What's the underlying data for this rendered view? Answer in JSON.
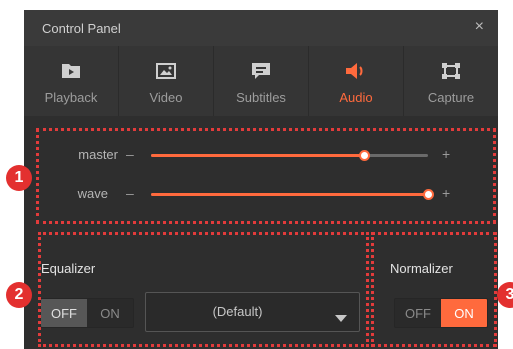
{
  "window": {
    "title": "Control Panel",
    "close_glyph": "×"
  },
  "tabs": [
    {
      "label": "Playback",
      "icon": "playback-icon",
      "active": false
    },
    {
      "label": "Video",
      "icon": "image-icon",
      "active": false
    },
    {
      "label": "Subtitles",
      "icon": "subtitles-icon",
      "active": false
    },
    {
      "label": "Audio",
      "icon": "speaker-icon",
      "active": true
    },
    {
      "label": "Capture",
      "icon": "capture-icon",
      "active": false
    }
  ],
  "sliders": [
    {
      "label": "master",
      "value": 0.77,
      "minus": "–",
      "plus": "+"
    },
    {
      "label": "wave",
      "value": 1.0,
      "minus": "–",
      "plus": "+"
    }
  ],
  "equalizer": {
    "title": "Equalizer",
    "toggle": {
      "off": "OFF",
      "on": "ON",
      "state": "OFF"
    },
    "preset": "(Default)"
  },
  "normalizer": {
    "title": "Normalizer",
    "toggle": {
      "off": "OFF",
      "on": "ON",
      "state": "ON"
    }
  },
  "callouts": [
    "1",
    "2",
    "3"
  ],
  "colors": {
    "accent": "#ff6a3d",
    "callout": "#e3302f",
    "panel": "#3a3a3a"
  }
}
